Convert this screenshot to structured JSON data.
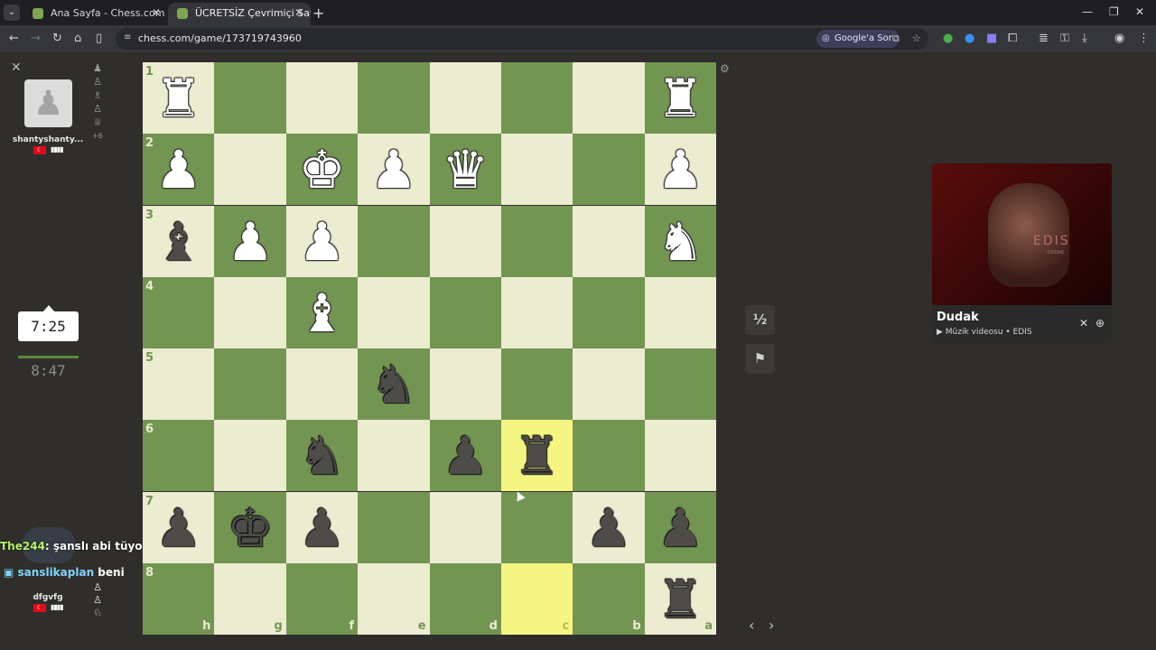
{
  "browser": {
    "tabs": [
      {
        "title": "Ana Sayfa - Chess.com",
        "active": false
      },
      {
        "title": "ÜCRETSİZ Çevrimiçi Satranç Oy",
        "active": true
      }
    ],
    "url": "chess.com/game/173719743960",
    "assistant_label": "Google'a Sor"
  },
  "top_player": {
    "name": "shantyshanty...",
    "captured": [
      "♟",
      "♙",
      "♗",
      "♙",
      "♕"
    ],
    "advantage": "+6",
    "clock_active": "7:25",
    "clock": "8:47"
  },
  "bottom_player": {
    "name": "dfgvfg",
    "pieces": [
      "♙",
      "♙",
      "♘"
    ]
  },
  "chat": {
    "line1_user": "The244",
    "line1_text": ": şanslı abi tüyo vermezse",
    "line2_user": "sanslikaplan",
    "line2_text": "beni"
  },
  "board": {
    "ranks": [
      "1",
      "2",
      "3",
      "4",
      "5",
      "6",
      "7",
      "8"
    ],
    "files": [
      "h",
      "g",
      "f",
      "e",
      "d",
      "c",
      "b",
      "a"
    ],
    "rows": [
      [
        "wR",
        "",
        "",
        "",
        "",
        "",
        "",
        "wR"
      ],
      [
        "wP",
        "",
        "wK",
        "wP",
        "wQ",
        "",
        "",
        "wP"
      ],
      [
        "bB",
        "wP",
        "wP",
        "",
        "",
        "",
        "",
        "wN"
      ],
      [
        "",
        "",
        "wB",
        "",
        "",
        "",
        "",
        ""
      ],
      [
        "",
        "",
        "",
        "bN",
        "",
        "",
        "",
        ""
      ],
      [
        "",
        "",
        "bN",
        "",
        "bP",
        "bR",
        "",
        ""
      ],
      [
        "bP",
        "bK",
        "bP",
        "",
        "",
        "",
        "bP",
        "bP"
      ],
      [
        "",
        "",
        "",
        "",
        "",
        "",
        "",
        "bR"
      ]
    ],
    "highlight": [
      [
        5,
        5
      ],
      [
        7,
        5
      ]
    ],
    "light_color": "#ebecd0",
    "dark_color": "#739552",
    "highlight_color": "#f5f682"
  },
  "controls": {
    "draw_label": "½",
    "resign_icon": "flag-icon"
  },
  "miniplayer": {
    "title": "Dudak",
    "subtitle": "Müzik videosu • EDIS",
    "thumb_text": "EDIS",
    "thumb_small": "DUDAK"
  }
}
